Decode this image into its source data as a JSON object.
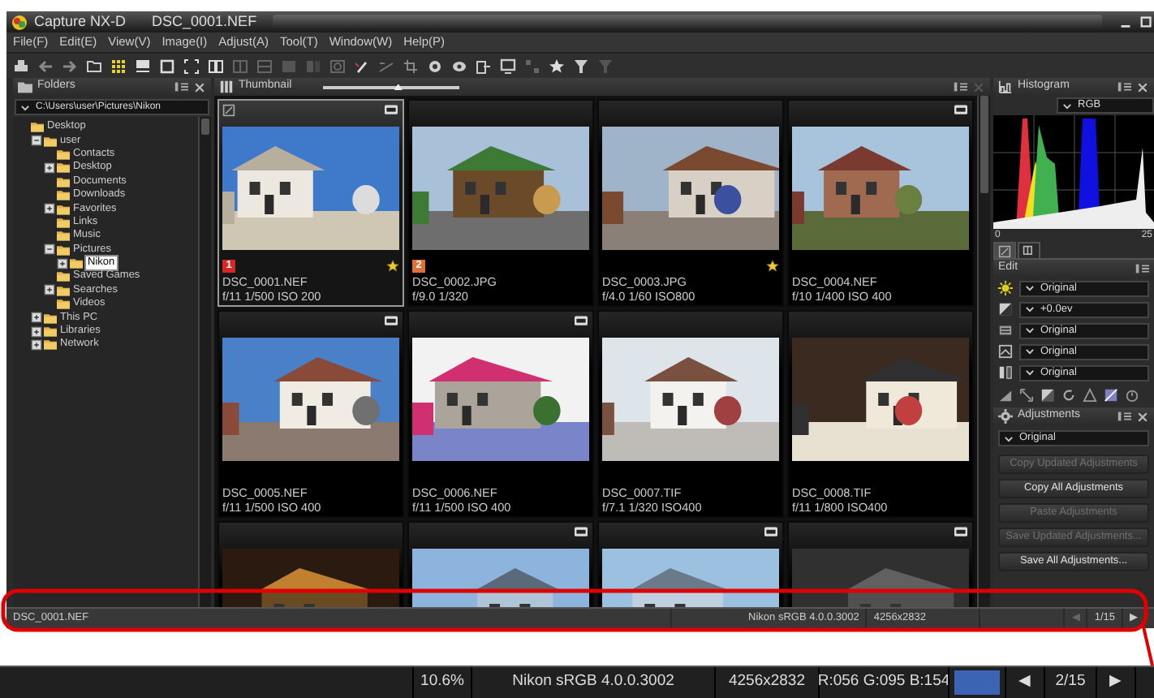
{
  "window": {
    "title": "Capture NX-D",
    "document": "DSC_0001.NEF"
  },
  "menu": [
    "File(F)",
    "Edit(E)",
    "View(V)",
    "Image(I)",
    "Adjust(A)",
    "Tool(T)",
    "Window(W)",
    "Help(P)"
  ],
  "folders": {
    "title": "Folders",
    "path": "C:\\Users\\user\\Pictures\\Nikon",
    "tree": [
      {
        "label": "Desktop",
        "expandable": false,
        "selected": false,
        "children": [
          {
            "label": "user",
            "expandable": true,
            "expanded": true,
            "selected": false,
            "children": [
              {
                "label": "Contacts",
                "expandable": false,
                "selected": false
              },
              {
                "label": "Desktop",
                "expandable": true,
                "expanded": false,
                "selected": false
              },
              {
                "label": "Documents",
                "expandable": false,
                "selected": false
              },
              {
                "label": "Downloads",
                "expandable": false,
                "selected": false
              },
              {
                "label": "Favorites",
                "expandable": true,
                "expanded": false,
                "selected": false
              },
              {
                "label": "Links",
                "expandable": false,
                "selected": false
              },
              {
                "label": "Music",
                "expandable": false,
                "selected": false
              },
              {
                "label": "Pictures",
                "expandable": true,
                "expanded": true,
                "selected": false,
                "children": [
                  {
                    "label": "Nikon",
                    "expandable": true,
                    "expanded": false,
                    "selected": true
                  }
                ]
              },
              {
                "label": "Saved Games",
                "expandable": false,
                "selected": false
              },
              {
                "label": "Searches",
                "expandable": true,
                "expanded": false,
                "selected": false
              },
              {
                "label": "Videos",
                "expandable": false,
                "selected": false
              }
            ]
          },
          {
            "label": "This PC",
            "expandable": true,
            "expanded": false,
            "selected": false
          },
          {
            "label": "Libraries",
            "expandable": true,
            "expanded": false,
            "selected": false
          },
          {
            "label": "Network",
            "expandable": true,
            "expanded": false,
            "selected": false
          }
        ]
      }
    ]
  },
  "thumbnail": {
    "title": "Thumbnail",
    "size_slider": {
      "level": 0.55
    },
    "items": [
      {
        "kind": "picture",
        "name": "DSC_0001.NEF",
        "info": "f/11 1/500 ISO 200",
        "selected": true,
        "edited": true,
        "raw": true,
        "starred": true,
        "label": {
          "text": "1",
          "color": "#d42828"
        }
      },
      {
        "kind": "picture",
        "name": "DSC_0002.JPG",
        "info": "f/9.0 1/320",
        "selected": false,
        "edited": false,
        "raw": false,
        "starred": false,
        "label": {
          "text": "2",
          "color": "#e0703a"
        }
      },
      {
        "kind": "picture",
        "name": "DSC_0003.JPG",
        "info": "f/4.0 1/60  ISO800",
        "selected": false,
        "edited": false,
        "raw": false,
        "starred": true
      },
      {
        "kind": "picture",
        "name": "DSC_0004.NEF",
        "info": "f/10 1/400 ISO 400",
        "selected": false,
        "edited": false,
        "raw": true,
        "starred": false
      },
      {
        "kind": "picture",
        "name": "DSC_0005.NEF",
        "info": "f/11 1/500 ISO 400",
        "selected": false,
        "edited": false,
        "raw": true,
        "starred": false
      },
      {
        "kind": "picture",
        "name": "DSC_0006.NEF",
        "info": "f/11 1/500 ISO 400",
        "selected": false,
        "edited": false,
        "raw": true,
        "starred": false
      },
      {
        "kind": "picture",
        "name": "DSC_0007.TIF",
        "info": "f/7.1 1/320  ISO400",
        "selected": false,
        "edited": false,
        "raw": false,
        "starred": false
      },
      {
        "kind": "picture",
        "name": "DSC_0008.TIF",
        "info": "f/11 1/800  ISO400",
        "selected": false,
        "edited": false,
        "raw": false,
        "starred": false
      },
      {
        "kind": "picture",
        "selected": false,
        "edited": false,
        "raw": false,
        "starred": false
      },
      {
        "kind": "picture",
        "selected": false,
        "edited": false,
        "raw": true,
        "starred": false
      },
      {
        "kind": "picture",
        "selected": false,
        "edited": false,
        "raw": true,
        "starred": false
      },
      {
        "kind": "picture",
        "selected": false,
        "edited": false,
        "raw": true,
        "starred": false
      }
    ]
  },
  "histogram": {
    "title": "Histogram",
    "channel": "RGB",
    "axis_min": "0",
    "axis_max": "25",
    "tabs": [
      {
        "selected": true
      },
      {
        "selected": false
      }
    ]
  },
  "edit": {
    "title": "Edit",
    "rows": [
      {
        "value": "Original"
      },
      {
        "value": "+0.0ev"
      },
      {
        "value": "Original"
      },
      {
        "value": "Original"
      },
      {
        "value": "Original"
      }
    ]
  },
  "adjustments": {
    "title": "Adjustments",
    "preset": "Original",
    "buttons": [
      {
        "label": "Copy Updated Adjustments",
        "disabled": true
      },
      {
        "label": "Copy All Adjustments",
        "disabled": false
      },
      {
        "label": "Paste Adjustments",
        "disabled": true
      },
      {
        "label": "Save Updated Adjustments...",
        "disabled": true
      },
      {
        "label": "Save All Adjustments...",
        "disabled": false
      }
    ]
  },
  "status_bar": {
    "file": "DSC_0001.NEF",
    "profile": "Nikon sRGB 4.0.0.3002",
    "size": "4256x2832",
    "prev": "◀",
    "prev_disabled": true,
    "page": "1/15",
    "next": "▶"
  },
  "zoom_bar": {
    "zoom": "10.6%",
    "profile": "Nikon sRGB 4.0.0.3002",
    "size": "4256x2832",
    "rgb": "R:056 G:095 B:154",
    "color": "#3c64b4",
    "prev": "◀",
    "page": "2/15",
    "next": "▶"
  }
}
